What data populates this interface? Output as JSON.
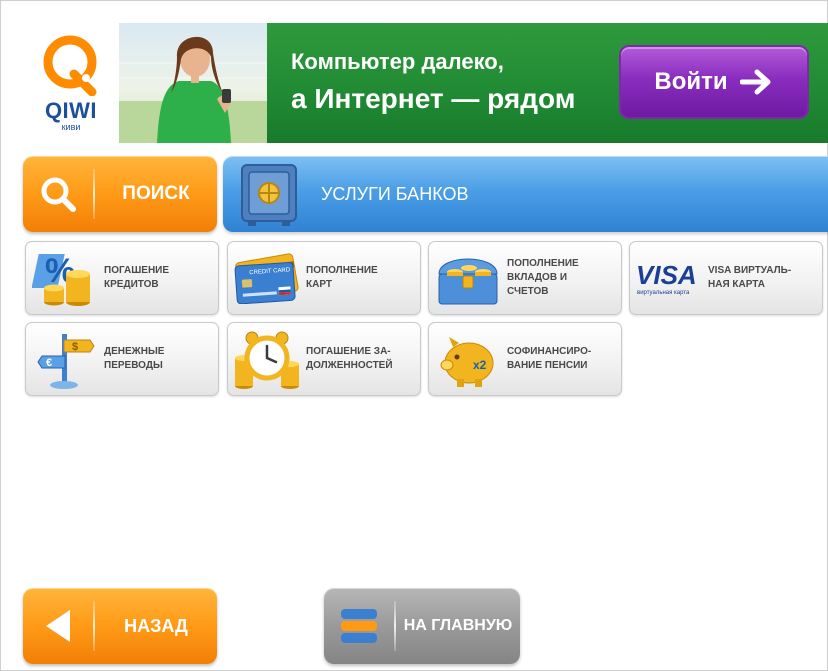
{
  "logo": {
    "word": "QIWI",
    "sub": "киви"
  },
  "banner": {
    "line1": "Компьютер далеко,",
    "line2": "а Интернет — рядом",
    "login_label": "Войти"
  },
  "search": {
    "label": "ПОИСК"
  },
  "bank_services": {
    "label": "УСЛУГИ БАНКОВ"
  },
  "tiles": [
    {
      "label": "ПОГАШЕНИЕ\nКРЕДИТОВ",
      "icon": "percent-coins-icon"
    },
    {
      "label": "ПОПОЛНЕНИЕ\nКАРТ",
      "icon": "credit-card-icon",
      "card_text": "CREDIT CARD"
    },
    {
      "label": "ПОПОЛНЕНИЕ\nВКЛАДОВ И\nСЧЕТОВ",
      "icon": "treasure-chest-icon"
    },
    {
      "label": "VISA ВИРТУАЛЬ-\nНАЯ КАРТА",
      "icon": "visa-icon",
      "visa_word": "VISA",
      "visa_sub": "виртуальная карта"
    },
    {
      "label": "ДЕНЕЖНЫЕ\nПЕРЕВОДЫ",
      "icon": "currency-signpost-icon"
    },
    {
      "label": "ПОГАШЕНИЕ ЗА-\nДОЛЖЕННОСТЕЙ",
      "icon": "alarm-clock-coins-icon"
    },
    {
      "label": "СОФИНАНСИРО-\nВАНИЕ ПЕНСИИ",
      "icon": "piggy-bank-icon",
      "badge": "x2"
    }
  ],
  "nav": {
    "back_label": "НАЗАД",
    "home_label": "НА ГЛАВНУЮ"
  },
  "colors": {
    "accent_orange": "#ff9a17",
    "banner_green": "#1f8a33",
    "login_purple": "#8a2dbf",
    "bank_blue": "#3b8fdc",
    "logo_blue": "#1d4f9c"
  }
}
